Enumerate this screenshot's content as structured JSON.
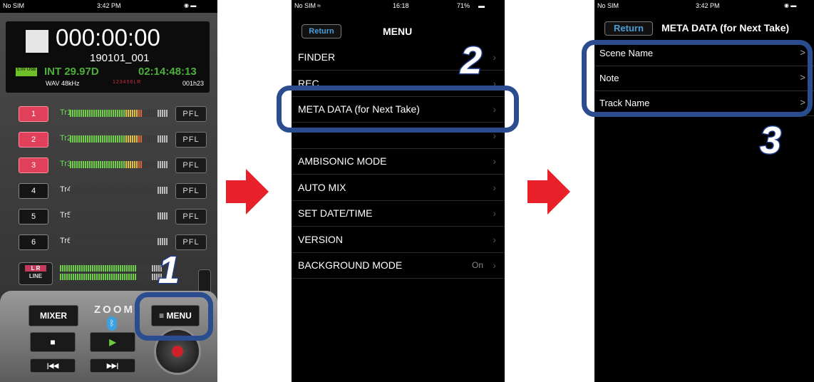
{
  "phone1": {
    "status": {
      "carrier": "No SIM",
      "time": "3:42 PM"
    },
    "display": {
      "timecode": "000:00:00",
      "take": "190101_001",
      "usb_badge": "5.0V USB",
      "tc_mode": "INT 29.97D",
      "remaining": "02:14:48:13",
      "format": "WAV 48kHz",
      "tracks_indicator": "123456LR",
      "remaining_short": "001h23"
    },
    "tracks": [
      {
        "num": "1",
        "label": "Tr1",
        "armed": true,
        "level": 0.72
      },
      {
        "num": "2",
        "label": "Tr2",
        "armed": true,
        "level": 0.72
      },
      {
        "num": "3",
        "label": "Tr3",
        "armed": true,
        "level": 0.72
      },
      {
        "num": "4",
        "label": "Tr4",
        "armed": false,
        "level": 0
      },
      {
        "num": "5",
        "label": "Tr5",
        "armed": false,
        "level": 0
      },
      {
        "num": "6",
        "label": "Tr6",
        "armed": false,
        "level": 0
      }
    ],
    "pfl_label": "PFL",
    "lr_label": "L R",
    "line_label": "LINE",
    "mixer_label": "MIXER",
    "brand_label": "ZOOM",
    "menu_label": "≡ MENU"
  },
  "phone2": {
    "status": {
      "carrier": "No SIM",
      "time": "16:18",
      "battery": "71%"
    },
    "return_label": "Return",
    "title": "MENU",
    "items": [
      {
        "label": "FINDER",
        "value": ""
      },
      {
        "label": "REC",
        "value": ""
      },
      {
        "label": "META DATA (for Next Take)",
        "value": ""
      },
      {
        "label": "",
        "value": ""
      },
      {
        "label": "AMBISONIC MODE",
        "value": ""
      },
      {
        "label": "AUTO MIX",
        "value": ""
      },
      {
        "label": "SET DATE/TIME",
        "value": ""
      },
      {
        "label": "VERSION",
        "value": ""
      },
      {
        "label": "BACKGROUND MODE",
        "value": "On"
      }
    ]
  },
  "phone3": {
    "status": {
      "carrier": "No SIM",
      "time": "3:42 PM"
    },
    "return_label": "Return",
    "title": "META DATA (for Next Take)",
    "items": [
      {
        "label": "Scene Name"
      },
      {
        "label": "Note"
      },
      {
        "label": "Track Name"
      }
    ]
  },
  "steps": [
    "1",
    "2",
    "3"
  ],
  "colors": {
    "highlight": "#2b4d8f",
    "arrow": "#e8202a",
    "armed": "#e0405a",
    "return_text": "#4b9ed8"
  }
}
